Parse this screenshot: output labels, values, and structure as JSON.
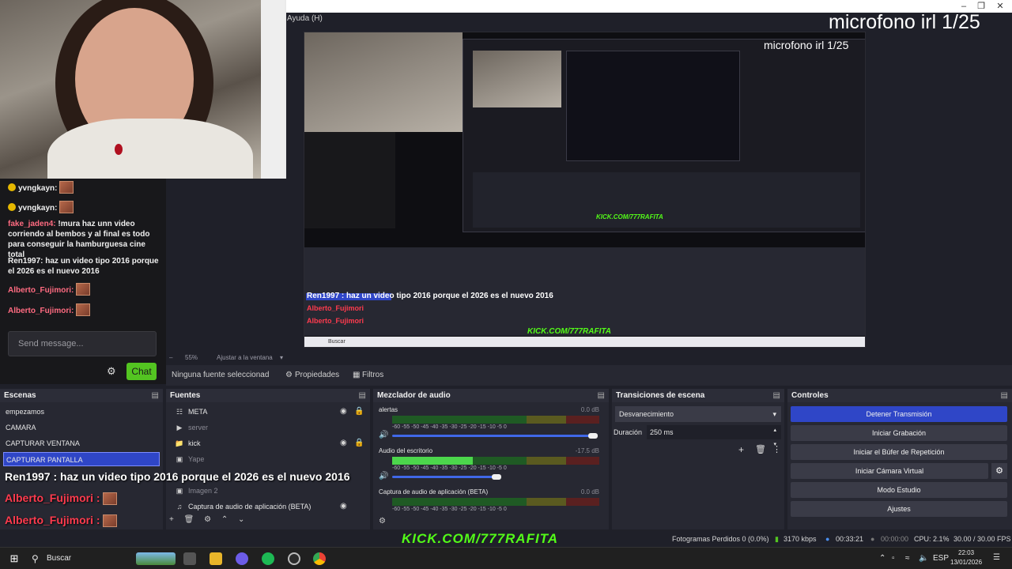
{
  "window": {
    "menu_help": "Ayuda (H)",
    "overlay_label": "microfono irl 1/25",
    "inner_overlay_label": "microfono irl 1/25"
  },
  "chat": {
    "messages": [
      {
        "user": "yvngkayn:",
        "text": ""
      },
      {
        "user": "yvngkayn:",
        "text": ""
      },
      {
        "user": "fake_jaden4:",
        "text": "!mura haz unn video corriendo al bembos y al final es todo para conseguir la hamburguesa cine total"
      },
      {
        "user": "Ren1997:",
        "text": "haz un video tipo 2016 porque el 2026 es el nuevo 2016"
      },
      {
        "user": "Alberto_Fujimori:",
        "text": ""
      },
      {
        "user": "Alberto_Fujimori:",
        "text": ""
      }
    ],
    "send_placeholder": "Send message...",
    "chat_button": "Chat"
  },
  "preview": {
    "zoom": "55%",
    "fit_label": "Ajustar a la ventana",
    "inner_caption": "Ren1997 : haz un video tipo 2016 porque el 2026 es el nuevo 2016",
    "inner_red1": "Alberto_Fujimori",
    "inner_red2": "Alberto_Fujimori",
    "inner_kick": "KICK.COM/777RAFITA",
    "inner_search": "Buscar"
  },
  "properties_bar": {
    "no_source": "Ninguna fuente seleccionad",
    "properties": "Propiedades",
    "filters": "Filtros"
  },
  "scenes": {
    "title": "Escenas",
    "items": [
      "empezamos",
      "CAMARA",
      "CAPTURAR VENTANA",
      "CAPTURAR PANTALLA"
    ],
    "selected_index": 3
  },
  "sources": {
    "title": "Fuentes",
    "items": [
      {
        "name": "META",
        "icon": "group-icon"
      },
      {
        "name": "server",
        "icon": "play-icon"
      },
      {
        "name": "kick",
        "icon": "folder-icon"
      },
      {
        "name": "Yape",
        "icon": "image-icon"
      },
      {
        "name": "Imagen 2",
        "icon": "image-icon"
      },
      {
        "name": "Captura de audio de aplicación (BETA)",
        "icon": "audio-icon"
      }
    ]
  },
  "mixer": {
    "title": "Mezclador de audio",
    "channels": [
      {
        "name": "alertas",
        "db": "0.0 dB",
        "level": 0
      },
      {
        "name": "Audio del escritorio",
        "db": "-17.5 dB",
        "level": 0.6
      },
      {
        "name": "Captura de audio de aplicación (BETA)",
        "db": "0.0 dB",
        "level": 0
      }
    ],
    "ticks": "-60  -55  -50  -45  -40  -35  -30  -25  -20  -15  -10   -5   0"
  },
  "transitions": {
    "title": "Transiciones de escena",
    "selected": "Desvanecimiento",
    "duration_label": "Duración",
    "duration_value": "250 ms"
  },
  "controls": {
    "title": "Controles",
    "buttons": [
      "Detener Transmisión",
      "Iniciar Grabación",
      "Iniciar el Búfer de Repetición",
      "Iniciar Cámara Virtual",
      "Modo Estudio",
      "Ajustes"
    ]
  },
  "overlay_chat": {
    "caption_user": "Ren1997",
    "caption_text": ": haz un video tipo 2016 porque el 2026 es el nuevo 2016",
    "red1": "Alberto_Fujimori",
    "red2": "Alberto_Fujimori"
  },
  "status": {
    "kick": "KICK.COM/777RAFITA",
    "frames_lost": "Fotogramas Perdidos 0 (0.0%)",
    "bitrate": "3170 kbps",
    "stream_time": "00:33:21",
    "rec_time": "00:00:00",
    "cpu": "CPU: 2.1%",
    "fps": "30.00 / 30.00 FPS"
  },
  "taskbar": {
    "search": "Buscar",
    "lang": "ESP",
    "time": "22:03",
    "date": "13/01/2026"
  }
}
